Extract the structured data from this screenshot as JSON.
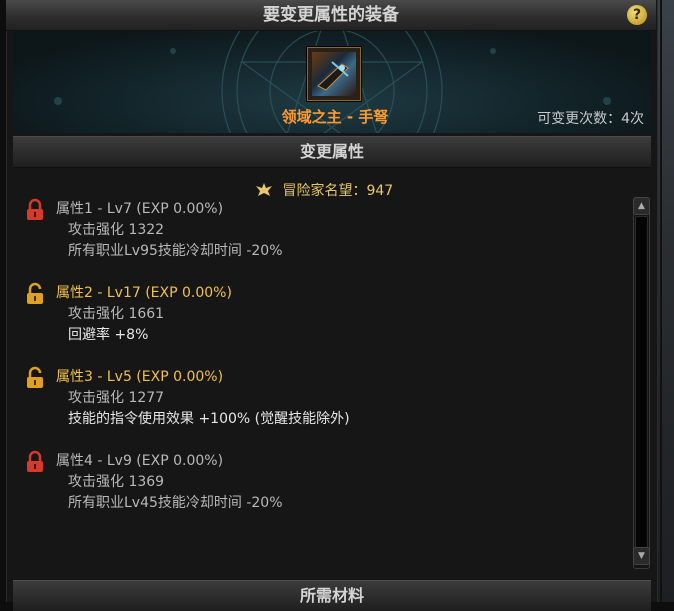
{
  "header": {
    "title": "要变更属性的装备",
    "help_label": "?"
  },
  "equipment": {
    "item_name": "领域之主 - 手弩",
    "change_count": "可变更次数：4次",
    "item_icon": "weapon-crossbow-icon"
  },
  "section": {
    "title": "变更属性"
  },
  "reputation": {
    "label": "冒险家名望",
    "value": "：947",
    "icon": "reputation-crest-icon"
  },
  "attributes": [
    {
      "title": "属性1 - Lv7 (EXP 0.00%)",
      "lock": "locked",
      "line1": "攻击强化 1322",
      "line2": "所有职业Lv95技能冷却时间 -20%"
    },
    {
      "title": "属性2 - Lv17 (EXP 0.00%)",
      "lock": "unlocked",
      "line1": "攻击强化 1661",
      "line2": "回避率 +8%"
    },
    {
      "title": "属性3 - Lv5 (EXP 0.00%)",
      "lock": "unlocked",
      "line1": "攻击强化 1277",
      "line2": "技能的指令使用效果 +100% (觉醒技能除外)"
    },
    {
      "title": "属性4 - Lv9 (EXP 0.00%)",
      "lock": "locked",
      "line1": "攻击强化 1369",
      "line2": "所有职业Lv45技能冷却时间 -20%"
    }
  ],
  "materials": {
    "title": "所需材料"
  },
  "colors": {
    "item_name": "#ff9a2e",
    "reputation": "#e8c86a",
    "unlocked_title": "#f0c050",
    "locked_icon": "#d63a2a",
    "unlocked_icon": "#e0a020"
  }
}
